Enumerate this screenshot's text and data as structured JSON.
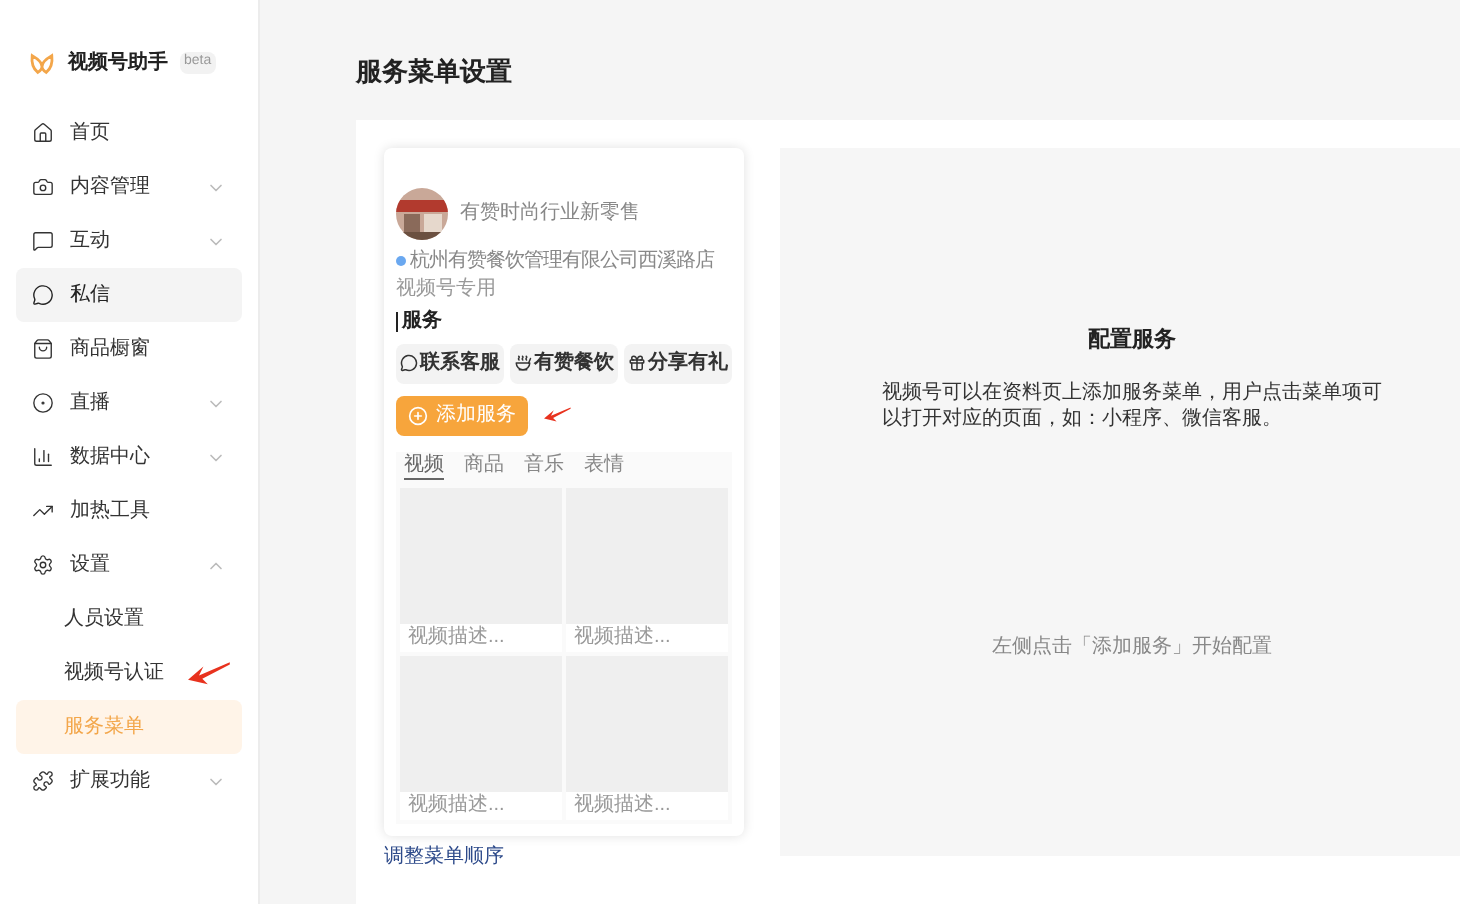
{
  "sidebar": {
    "app_name": "视频号助手",
    "badge": "beta",
    "items": [
      {
        "label": "首页",
        "selected": false
      },
      {
        "label": "内容管理",
        "selected": false,
        "expanded": false
      },
      {
        "label": "互动",
        "selected": false,
        "expanded": false
      },
      {
        "label": "私信",
        "selected": true
      },
      {
        "label": "商品橱窗",
        "selected": false
      },
      {
        "label": "直播",
        "selected": false,
        "expanded": false
      },
      {
        "label": "数据中心",
        "selected": false,
        "expanded": false
      },
      {
        "label": "加热工具",
        "selected": false
      },
      {
        "label": "设置",
        "selected": false,
        "expanded": true,
        "children": [
          {
            "label": "人员设置",
            "selected": false
          },
          {
            "label": "视频号认证",
            "selected": false
          },
          {
            "label": "服务菜单",
            "selected": true
          }
        ]
      },
      {
        "label": "扩展功能",
        "selected": false,
        "expanded": false
      }
    ]
  },
  "page_title": "服务菜单设置",
  "preview": {
    "account_name": "有赞时尚行业新零售",
    "location": "杭州有赞餐饮管理有限公司西溪路店",
    "tag": "视频号专用",
    "section_title": "服务",
    "services": [
      "联系客服",
      "有赞餐饮",
      "分享有礼"
    ],
    "add_button": "添加服务",
    "tabs": [
      {
        "label": "视频",
        "selected": true
      },
      {
        "label": "商品",
        "selected": false
      },
      {
        "label": "音乐",
        "selected": false
      },
      {
        "label": "表情",
        "selected": false
      }
    ],
    "videos": [
      {
        "caption": "视频描述..."
      },
      {
        "caption": "视频描述..."
      },
      {
        "caption": "视频描述..."
      },
      {
        "caption": "视频描述..."
      }
    ]
  },
  "config": {
    "title": "配置服务",
    "description": "视频号可以在资料页上添加服务菜单，用户点击菜单项可以打开对应的页面，如：小程序、微信客服。",
    "hint": "左侧点击「添加服务」开始配置"
  },
  "footer_link": "调整菜单顺序"
}
